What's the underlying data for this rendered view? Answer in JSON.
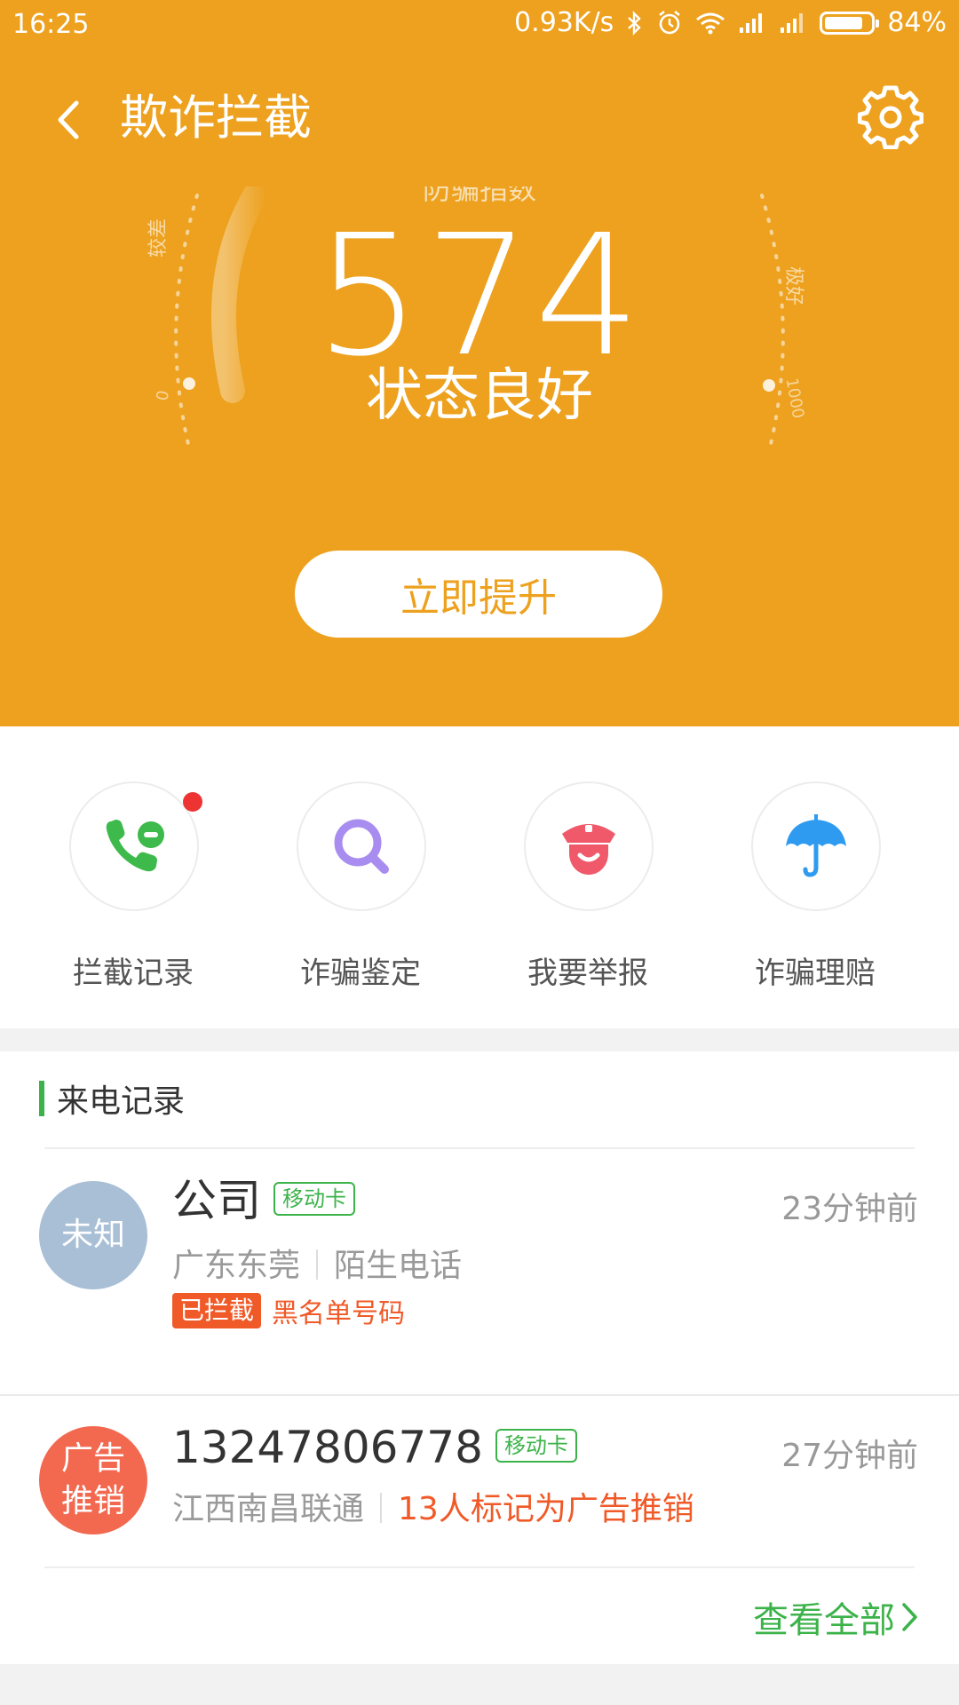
{
  "status_bar": {
    "time": "16:25",
    "network_speed": "0.93K/s",
    "battery": "84%",
    "battery_level": 0.84
  },
  "header": {
    "title": "欺诈拦截",
    "back_icon": "chevron-left-icon",
    "settings_icon": "gear-icon"
  },
  "score": {
    "cut_label": "防骗指数",
    "value": "574",
    "status": "状态良好",
    "low_label": "较差",
    "high_label": "极好",
    "min": "0",
    "max": "1000"
  },
  "boost_button": "立即提升",
  "actions": [
    {
      "label": "拦截记录",
      "icon": "phone-block-icon",
      "color": "#3dba4b",
      "has_badge": true
    },
    {
      "label": "诈骗鉴定",
      "icon": "search-icon",
      "color": "#a88cf0"
    },
    {
      "label": "我要举报",
      "icon": "police-icon",
      "color": "#f0596a"
    },
    {
      "label": "诈骗理赔",
      "icon": "umbrella-icon",
      "color": "#2e9bf0"
    }
  ],
  "records": {
    "title": "来电记录",
    "items": [
      {
        "avatar": "未知",
        "name": "公司",
        "sim": "移动卡",
        "time": "23分钟前",
        "location": "广东东莞",
        "type": "陌生电话",
        "tag": "已拦截",
        "reason": "黑名单号码"
      },
      {
        "avatar_line1": "广告",
        "avatar_line2": "推销",
        "name": "13247806778",
        "sim": "移动卡",
        "time": "27分钟前",
        "location": "江西南昌联通",
        "note": "13人标记为广告推销"
      }
    ],
    "view_all": "查看全部"
  },
  "colors": {
    "header_bg": "#EDA11E",
    "accent_green": "#3cb34a",
    "warning": "#F05A28"
  }
}
